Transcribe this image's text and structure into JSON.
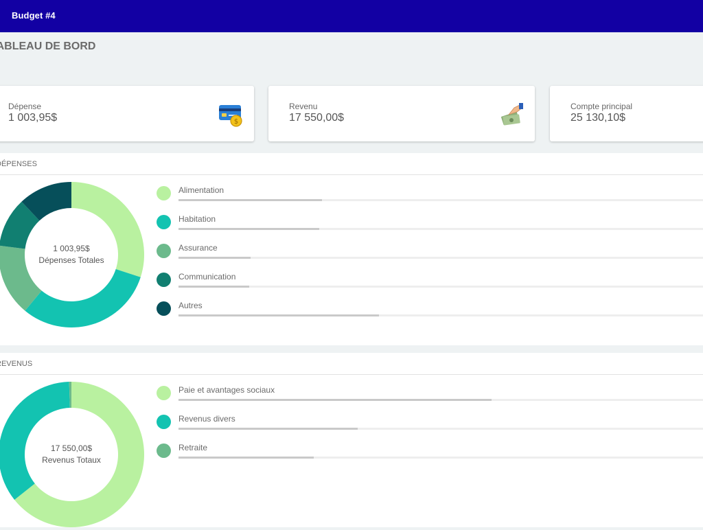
{
  "header": {
    "title": "Budget #4"
  },
  "page": {
    "title": "TABLEAU DE BORD"
  },
  "cards": [
    {
      "label": "Dépense",
      "value": "1 003,95$",
      "icon": "credit-card-icon"
    },
    {
      "label": "Revenu",
      "value": "17 550,00$",
      "icon": "money-hand-icon"
    },
    {
      "label": "Compte principal",
      "value": "25 130,10$",
      "icon": ""
    }
  ],
  "expenses": {
    "title": "DÉPENSES",
    "center_value": "1 003,95$",
    "center_label": "Dépenses Totales",
    "items": [
      {
        "label": "Alimentation",
        "color": "#b9f1a0",
        "share": 0.273
      },
      {
        "label": "Habitation",
        "color": "#13c3b1",
        "share": 0.268
      },
      {
        "label": "Assurance",
        "color": "#6cba8c",
        "share": 0.137
      },
      {
        "label": "Communication",
        "color": "#117f71",
        "share": 0.135
      },
      {
        "label": "Autres",
        "color": "#064f5a",
        "share": 0.382
      }
    ]
  },
  "revenues": {
    "title": "REVENUS",
    "center_value": "17 550,00$",
    "center_label": "Revenus Totaux",
    "items": [
      {
        "label": "Paie et avantages sociaux",
        "color": "#b9f1a0",
        "share": 0.597
      },
      {
        "label": "Revenus divers",
        "color": "#13c3b1",
        "share": 0.342
      },
      {
        "label": "Retraite",
        "color": "#6cba8c",
        "share": 0.258
      }
    ]
  },
  "chart_data": [
    {
      "type": "pie",
      "categories": [
        "Alimentation",
        "Habitation",
        "Assurance",
        "Communication",
        "Autres"
      ],
      "values": [
        30,
        31,
        16,
        11,
        12
      ],
      "title": "",
      "colors": [
        "#b9f1a0",
        "#13c3b1",
        "#6cba8c",
        "#117f71",
        "#064f5a"
      ]
    },
    {
      "type": "pie",
      "categories": [
        "Paie et avantages sociaux",
        "Revenus divers",
        "Retraite"
      ],
      "values": [
        64.3,
        35.2,
        0.5
      ],
      "title": "",
      "colors": [
        "#b9f1a0",
        "#13c3b1",
        "#6cba8c"
      ]
    }
  ]
}
